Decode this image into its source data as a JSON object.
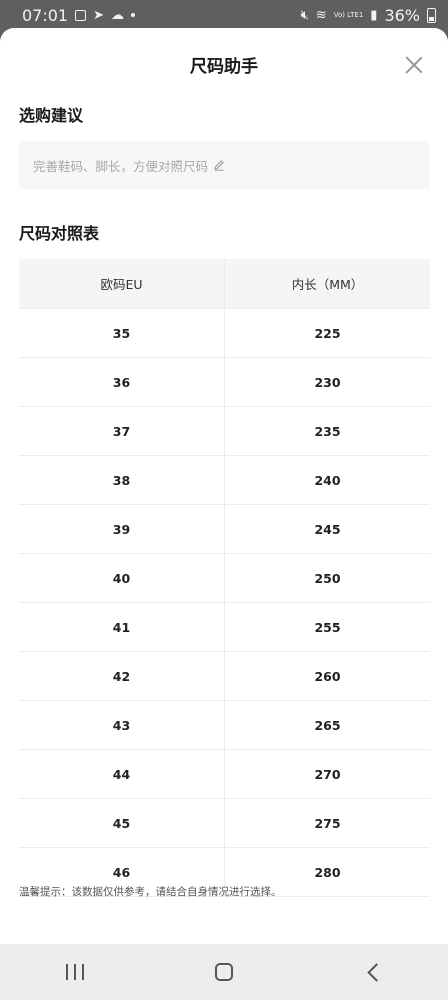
{
  "status_bar": {
    "time": "07:01",
    "battery": "36%",
    "lte": "Vo) LTE1"
  },
  "sheet": {
    "title": "尺码助手",
    "advice_section_title": "选购建议",
    "advice_placeholder": "完善鞋码、脚长，方便对照尺码",
    "table_section_title": "尺码对照表",
    "table": {
      "headers": [
        "欧码EU",
        "内长（MM）"
      ],
      "rows": [
        [
          "35",
          "225"
        ],
        [
          "36",
          "230"
        ],
        [
          "37",
          "235"
        ],
        [
          "38",
          "240"
        ],
        [
          "39",
          "245"
        ],
        [
          "40",
          "250"
        ],
        [
          "41",
          "255"
        ],
        [
          "42",
          "260"
        ],
        [
          "43",
          "265"
        ],
        [
          "44",
          "270"
        ],
        [
          "45",
          "275"
        ],
        [
          "46",
          "280"
        ]
      ]
    },
    "tip": "温馨提示：该数据仅供参考，请结合自身情况进行选择。"
  },
  "icons": {
    "close": "close-icon",
    "edit": "pencil-icon",
    "nav": [
      "recent-apps-icon",
      "home-icon",
      "back-icon"
    ]
  },
  "colors": {
    "overlay": "#5e5e5e",
    "sheet_bg": "#ffffff",
    "advice_bg": "#f7f7f9",
    "table_header_bg": "#f5f5f7",
    "placeholder_text": "#a8a8a8"
  }
}
